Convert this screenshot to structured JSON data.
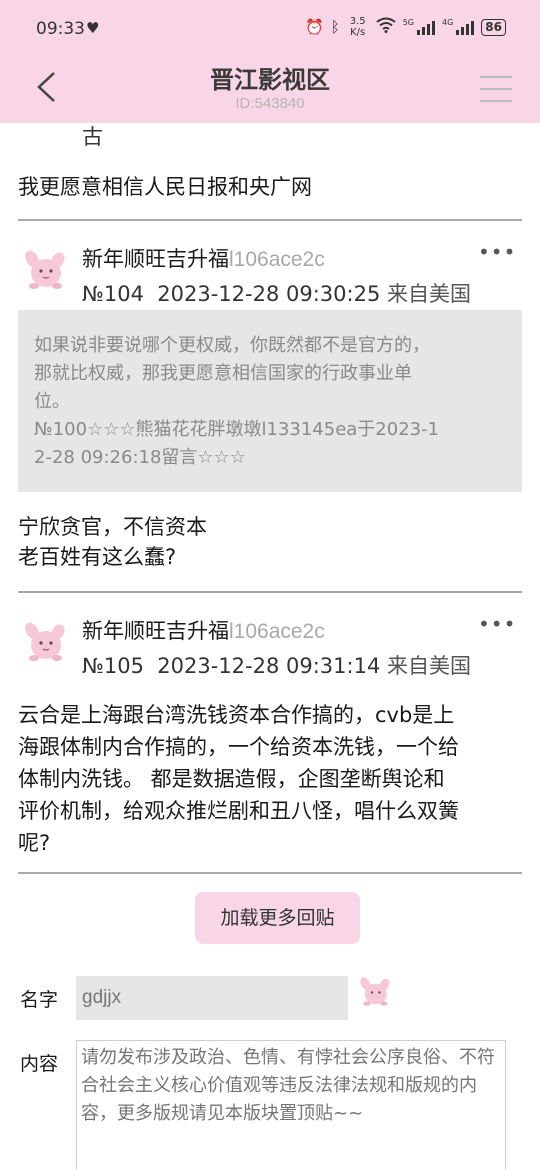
{
  "status": {
    "time": "09:33",
    "speed_top": "3.5",
    "speed_bottom": "K/s",
    "net1": "5G",
    "net2": "4G",
    "battery": "86"
  },
  "header": {
    "title": "晋江影视区",
    "subtitle": "ID:543840"
  },
  "previous_post": {
    "tail": "古",
    "text": "我更愿意相信人民日报和央广网"
  },
  "posts": [
    {
      "author": "新年顺旺吉升福",
      "uid": "l106ace2c",
      "number": "№104",
      "datetime": "2023-12-28 09:30:25",
      "location": "来自美国",
      "more": "•••",
      "quote": {
        "line1": "如果说非要说哪个更权威，你既然都不是官方的，",
        "line2": "那就比权威，那我更愿意相信国家的行政事业单",
        "line3": "位。",
        "line4": "№100☆☆☆熊猫花花胖墩墩l133145ea于2023-1",
        "line5": "2-28 09:26:18留言☆☆☆"
      },
      "body1": "宁欣贪官，不信资本",
      "body2": "老百姓有这么蠢?"
    },
    {
      "author": "新年顺旺吉升福",
      "uid": "l106ace2c",
      "number": "№105",
      "datetime": "2023-12-28 09:31:14",
      "location": "来自美国",
      "more": "•••",
      "body1": "云合是上海跟台湾洗钱资本合作搞的，cvb是上",
      "body2": "海跟体制内合作搞的，一个给资本洗钱，一个给",
      "body3": "体制内洗钱。 都是数据造假，企图垄断舆论和",
      "body4": "评价机制，给观众推烂剧和丑八怪，唱什么双簧",
      "body5": "呢?"
    }
  ],
  "load_more": "加载更多回贴",
  "form": {
    "name_label": "名字",
    "name_value": "gdjjx",
    "content_label": "内容",
    "content_placeholder": "请勿发布涉及政治、色情、有悖社会公序良俗、不符合社会主义核心价值观等违反法律法规和版规的内容，更多版规请见本版块置顶贴~~"
  },
  "colors": {
    "header_bg": "#f8d6e8",
    "quote_bg": "#e6e6e6",
    "uid": "#a8a8a8"
  }
}
